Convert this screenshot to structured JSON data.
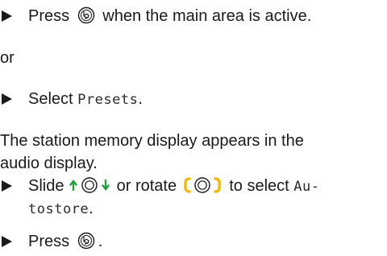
{
  "steps": {
    "step1_press": "Press",
    "step1_rest": "when the main area is active.",
    "or": "or",
    "step2_select": "Select",
    "step2_item": "Presets",
    "step2_end": ".",
    "paragraph_line1": "The station memory display appears in the",
    "paragraph_line2": "audio display.",
    "step3_slide": "Slide",
    "step3_or_rotate": "or rotate",
    "step3_to_select": "to select",
    "step3_item_part1": "Au-",
    "step3_item_part2": "tostore",
    "step3_end": ".",
    "step4_press": "Press",
    "step4_end": "."
  },
  "icons": {
    "press": "controller-press-icon",
    "slide": "controller-slide-icon",
    "rotate": "controller-rotate-icon"
  },
  "colors": {
    "text": "#1a1a1a",
    "slide_arrow": "#22a03a",
    "rotate_bracket": "#f5b800"
  }
}
